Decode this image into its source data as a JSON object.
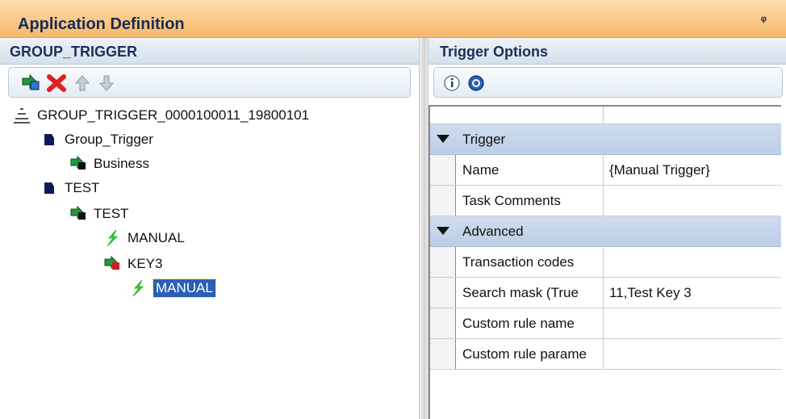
{
  "window": {
    "title": "Application Definition",
    "pin_glyph": "ᵠ"
  },
  "left_pane": {
    "header": "GROUP_TRIGGER",
    "toolbar": [
      {
        "name": "add-icon"
      },
      {
        "name": "delete-icon"
      },
      {
        "name": "move-up-icon"
      },
      {
        "name": "move-down-icon"
      }
    ],
    "tree": [
      {
        "label": "GROUP_TRIGGER_0000100011_19800101",
        "icon": "root-icon"
      },
      {
        "label": "Group_Trigger",
        "icon": "group-icon"
      },
      {
        "label": "Business",
        "icon": "business-icon"
      },
      {
        "label": "TEST",
        "icon": "group-icon"
      },
      {
        "label": "TEST",
        "icon": "business-icon"
      },
      {
        "label": "MANUAL",
        "icon": "trigger-icon"
      },
      {
        "label": "KEY3",
        "icon": "key-icon"
      },
      {
        "label": "MANUAL",
        "icon": "trigger-icon",
        "selected": true
      }
    ]
  },
  "right_pane": {
    "header": "Trigger Options",
    "toolbar": [
      {
        "name": "info-icon"
      },
      {
        "name": "help-icon"
      }
    ],
    "categories": [
      {
        "label": "Trigger",
        "props": [
          {
            "name": "Name",
            "value": "{Manual Trigger}"
          },
          {
            "name": "Task Comments",
            "value": ""
          }
        ]
      },
      {
        "label": "Advanced",
        "props": [
          {
            "name": "Transaction codes",
            "value": ""
          },
          {
            "name": "Search mask (True",
            "value": "11,Test Key 3"
          },
          {
            "name": "Custom rule name",
            "value": ""
          },
          {
            "name": "Custom rule parame",
            "value": ""
          }
        ]
      }
    ]
  },
  "colors": {
    "title_bar": "#f9c987",
    "category_bg": "#c6d5ea",
    "selection": "#2b5fb5"
  }
}
